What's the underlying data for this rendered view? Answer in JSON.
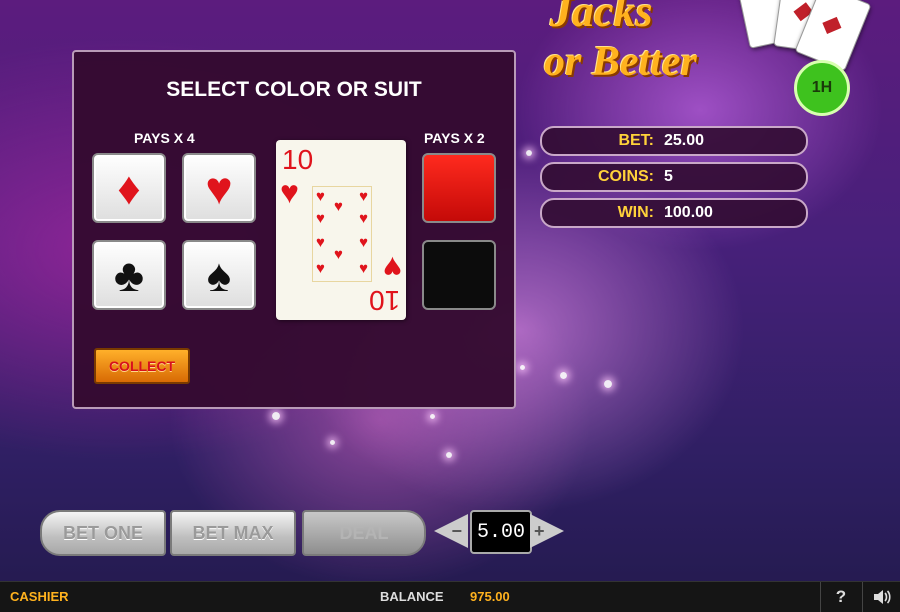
{
  "logo": {
    "line1": "Jacks",
    "line2": "or Better",
    "badge": "1H"
  },
  "gamble": {
    "title": "SELECT COLOR OR SUIT",
    "pays_suit": "PAYS X 4",
    "pays_color": "PAYS X 2",
    "suits": [
      {
        "name": "diamond",
        "glyph": "♦",
        "color": "red"
      },
      {
        "name": "heart",
        "glyph": "♥",
        "color": "red"
      },
      {
        "name": "club",
        "glyph": "♣",
        "color": "black"
      },
      {
        "name": "spade",
        "glyph": "♠",
        "color": "black"
      }
    ],
    "colors": [
      {
        "name": "red",
        "hex": "#e0141c"
      },
      {
        "name": "black",
        "hex": "#0c0c0c"
      }
    ],
    "card": {
      "rank": "10",
      "suit_glyph": "♥",
      "suit": "hearts"
    },
    "collect_label": "COLLECT"
  },
  "info": {
    "bet": {
      "label": "BET:",
      "value": "25.00"
    },
    "coins": {
      "label": "COINS:",
      "value": "5"
    },
    "win": {
      "label": "WIN:",
      "value": "100.00"
    }
  },
  "controls": {
    "bet_one": "BET ONE",
    "bet_max": "BET MAX",
    "deal": "DEAL",
    "minus": "−",
    "plus": "+",
    "coin_value": "5.00"
  },
  "status_bar": {
    "cashier": "CASHIER",
    "balance_label": "BALANCE",
    "balance_value": "975.00",
    "help": "?",
    "sound_icon": "speaker-icon"
  },
  "colors": {
    "accent": "#ffb21e",
    "panel": "#340a30",
    "label": "#ffd23a"
  }
}
